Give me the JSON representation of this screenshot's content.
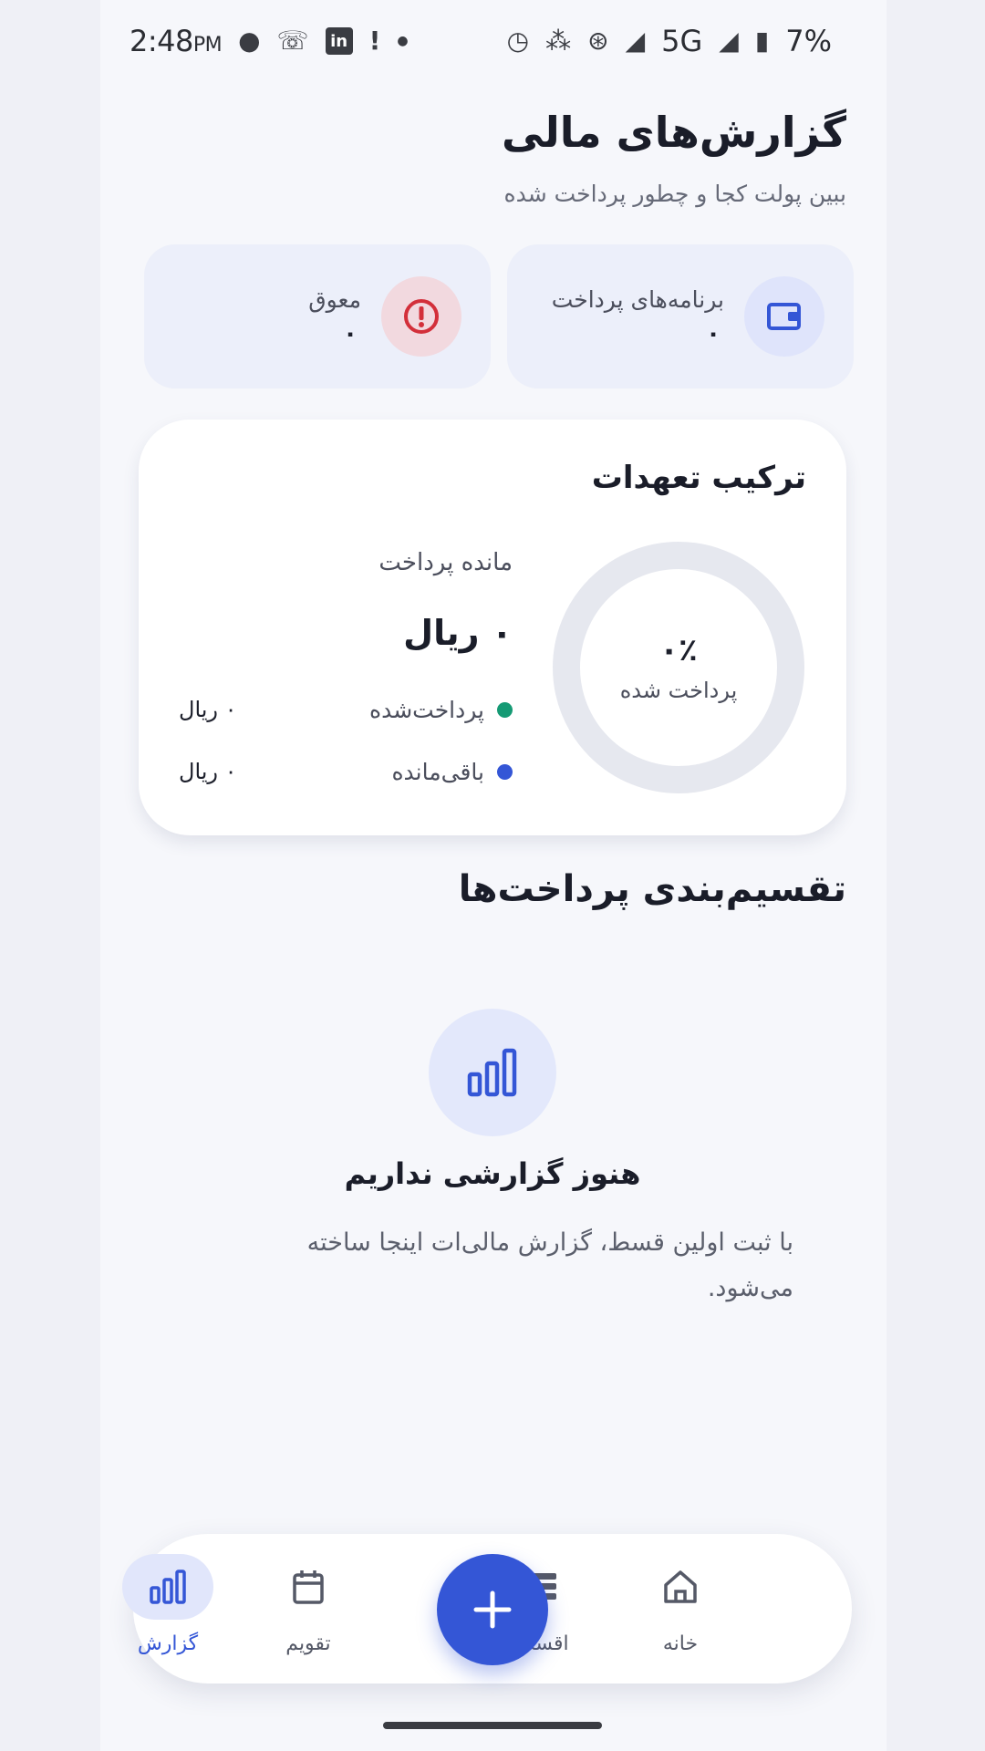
{
  "status_bar": {
    "time": "2:48",
    "ampm": "PM",
    "network": "5G",
    "battery": "7%"
  },
  "header": {
    "title": "گزارش‌های مالی",
    "subtitle": "ببین پولت کجا و چطور پرداخت شده"
  },
  "stats": {
    "plans": {
      "label": "برنامه‌های پرداخت",
      "value": "۰",
      "icon": "wallet-icon",
      "color": "#3456d6"
    },
    "overdue": {
      "label": "معوق",
      "value": "۰",
      "icon": "alert-circle-icon",
      "color": "#d32f3a"
    }
  },
  "composition": {
    "title": "ترکیب تعهدات",
    "percent": "۰٪",
    "percent_label": "پرداخت شده",
    "paid_fraction": 0,
    "remain_label": "مانده پرداخت",
    "remain_amount": "۰ ریال",
    "legend": [
      {
        "name": "پرداخت‌شده",
        "value": "۰ ریال",
        "color": "#159a74"
      },
      {
        "name": "باقی‌مانده",
        "value": "۰ ریال",
        "color": "#3456d6"
      }
    ]
  },
  "breakdown": {
    "title": "تقسیم‌بندی پرداخت‌ها",
    "empty_title": "هنوز گزارشی نداریم",
    "empty_desc": "با ثبت اولین قسط، گزارش مالی‌ات اینجا ساخته می‌شود."
  },
  "nav": {
    "home": "خانه",
    "installments": "اقساط",
    "calendar": "تقویم",
    "reports": "گزارش",
    "active": "reports"
  },
  "colors": {
    "accent": "#3456d6",
    "paid": "#159a74",
    "danger": "#d32f3a"
  }
}
